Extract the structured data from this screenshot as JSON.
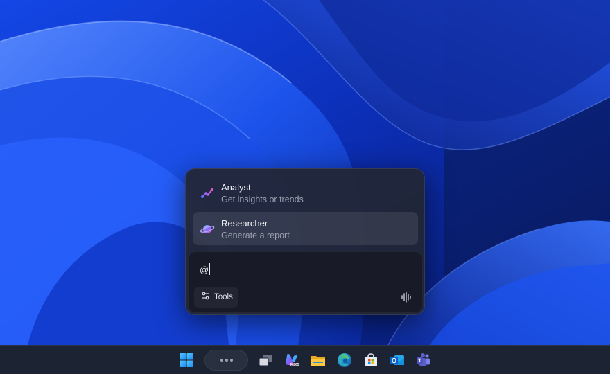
{
  "popup": {
    "suggestions": [
      {
        "title": "Analyst",
        "subtitle": "Get insights or trends",
        "icon": "analyst-chart-icon"
      },
      {
        "title": "Researcher",
        "subtitle": "Generate a report",
        "icon": "researcher-planet-icon"
      }
    ],
    "composer": {
      "value": "@",
      "tools_label": "Tools"
    }
  },
  "taskbar": {
    "items": [
      {
        "icon": "windows-start-icon"
      },
      {
        "icon": "copilot-pill-icon"
      },
      {
        "icon": "task-view-icon"
      },
      {
        "icon": "m365-copilot-icon",
        "badge": "M365"
      },
      {
        "icon": "file-explorer-icon"
      },
      {
        "icon": "edge-browser-icon"
      },
      {
        "icon": "microsoft-store-icon"
      },
      {
        "icon": "outlook-icon"
      },
      {
        "icon": "teams-icon"
      }
    ]
  },
  "colors": {
    "wallpaper_base": "#0a1a6e",
    "wallpaper_highlight": "#3f7dff",
    "popup_bg": "#222634",
    "taskbar_bg": "#1c2333",
    "highlight_row": "#2e3242"
  }
}
